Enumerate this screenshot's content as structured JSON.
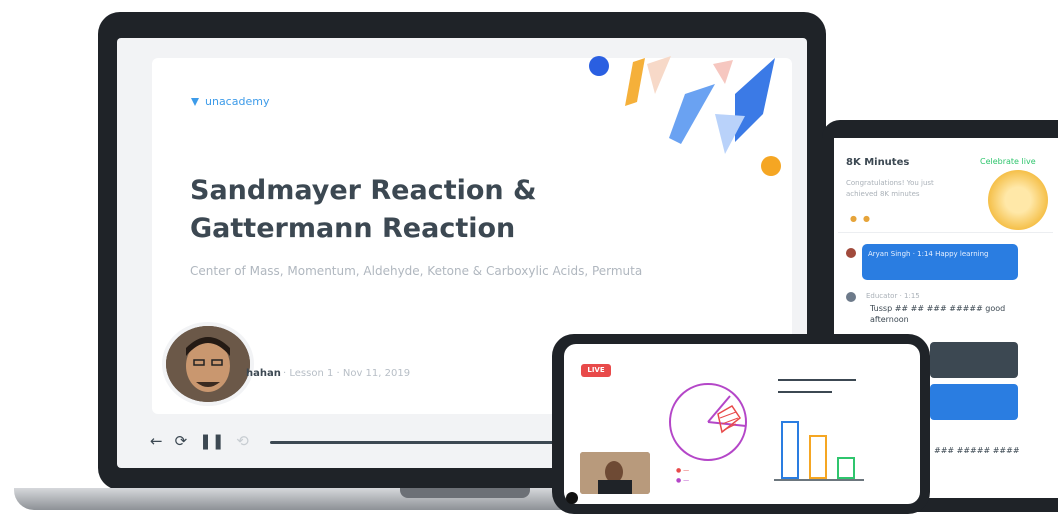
{
  "lesson": {
    "brand": "unacademy",
    "title": "Sandmayer Reaction & Gattermann Reaction",
    "subtitle": "Center of Mass, Momentum, Aldehyde, Ketone & Carboxylic Acids, Permuta",
    "author": "hahan",
    "meta": "· Lesson 1 · Nov 11, 2019"
  },
  "player": {
    "back_icon": "arrow-left-icon",
    "rewind_icon": "rewind-icon",
    "pause_icon": "pause-icon",
    "forward_icon": "forward-icon"
  },
  "chat": {
    "title": "8K Minutes",
    "link": "Celebrate live",
    "congrats": "Congratulations! You just achieved 8K minutes",
    "msg1": "Aryan Singh · 1:14 Happy learning",
    "user2": "Educator · 1:15",
    "msg2": "Tussp ## ## ### ##### good afternoon",
    "msg4": "### ##### ####"
  },
  "phone": {
    "live_badge": "LIVE"
  },
  "colors": {
    "accent": "#2a7de1",
    "text_dark": "#3c4852",
    "live": "#e84a4a",
    "green": "#2fc56d"
  }
}
